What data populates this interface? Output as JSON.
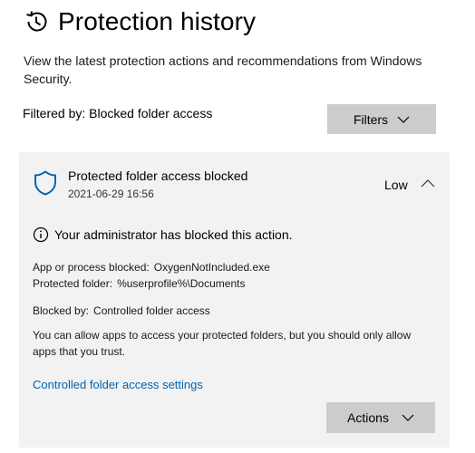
{
  "page": {
    "title": "Protection history",
    "subtitle": "View the latest protection actions and recommendations from Windows Security."
  },
  "filter": {
    "label": "Filtered by: Blocked folder access",
    "button_label": "Filters"
  },
  "event": {
    "title": "Protected folder access blocked",
    "date": "2021-06-29 16:56",
    "severity": "Low",
    "info_message": "Your administrator has blocked this action.",
    "app_label": "App or process blocked:",
    "app_value": "OxygenNotIncluded.exe",
    "folder_label": "Protected folder:",
    "folder_value": "%userprofile%\\Documents",
    "blocked_by_label": "Blocked by:",
    "blocked_by_value": "Controlled folder access",
    "explanation": "You can allow apps to access your protected folders, but you should only allow apps that you trust.",
    "settings_link": "Controlled folder access settings",
    "actions_label": "Actions"
  },
  "icons": {
    "header": "history-icon",
    "event": "shield-icon",
    "info": "info-icon",
    "expand": "chevron-up-icon",
    "dropdown": "chevron-down-icon"
  },
  "colors": {
    "accent": "#0063b1",
    "shield": "#0063b1",
    "card_background": "#f2f2f2",
    "button_background": "#cccccc"
  }
}
